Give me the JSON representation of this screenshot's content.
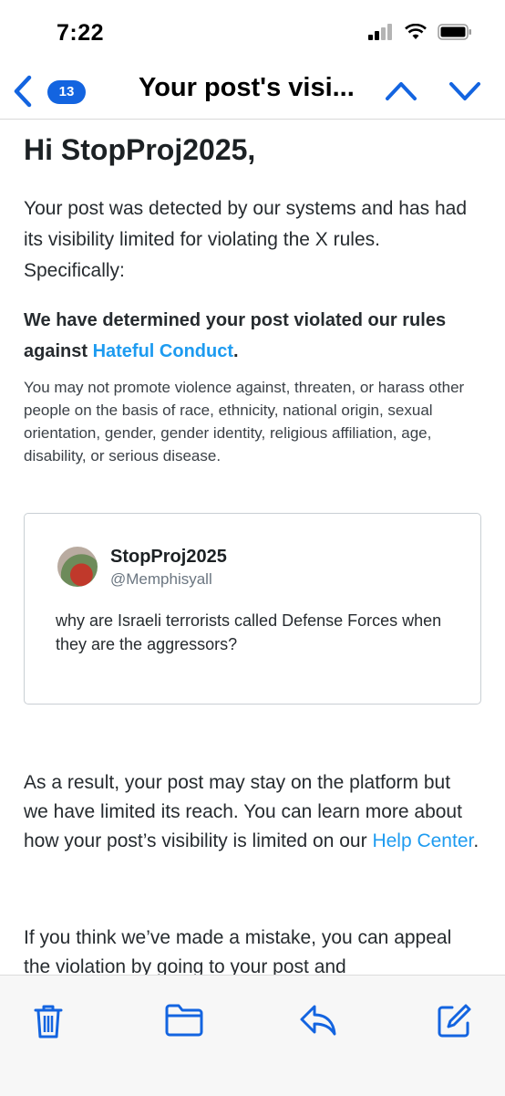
{
  "status_bar": {
    "time": "7:22"
  },
  "nav": {
    "unread_count": "13",
    "subject": "Your post's visi..."
  },
  "email": {
    "greeting": "Hi StopProj2025,",
    "intro": "Your post was detected by our systems and has had its visibility limited for violating the X rules. Specifically:",
    "determination_prefix": "We have determined your post violated our rules against ",
    "determination_link": "Hateful Conduct",
    "determination_suffix": ".",
    "policy_text": "You may not promote violence against, threaten, or harass other people on the basis of race, ethnicity, national origin, sexual orientation, gender, gender identity, religious affiliation, age, disability, or serious disease.",
    "tweet": {
      "display_name": "StopProj2025",
      "handle": "@Memphisyall",
      "text": "why are Israeli terrorists called Defense Forces when they are the aggressors?"
    },
    "result_text": "As a result, your post may stay on the platform but we have limited its reach. You can learn more about how your post’s visibility is limited on our ",
    "result_link": "Help Center",
    "result_suffix": ".",
    "appeal_text": "If you think we’ve made a mistake, you can appeal the violation by going to your post and"
  },
  "colors": {
    "accent": "#1364e0",
    "link": "#1d9bf0"
  },
  "toolbar": {
    "icons": [
      "trash-icon",
      "folder-icon",
      "reply-icon",
      "compose-icon"
    ]
  }
}
